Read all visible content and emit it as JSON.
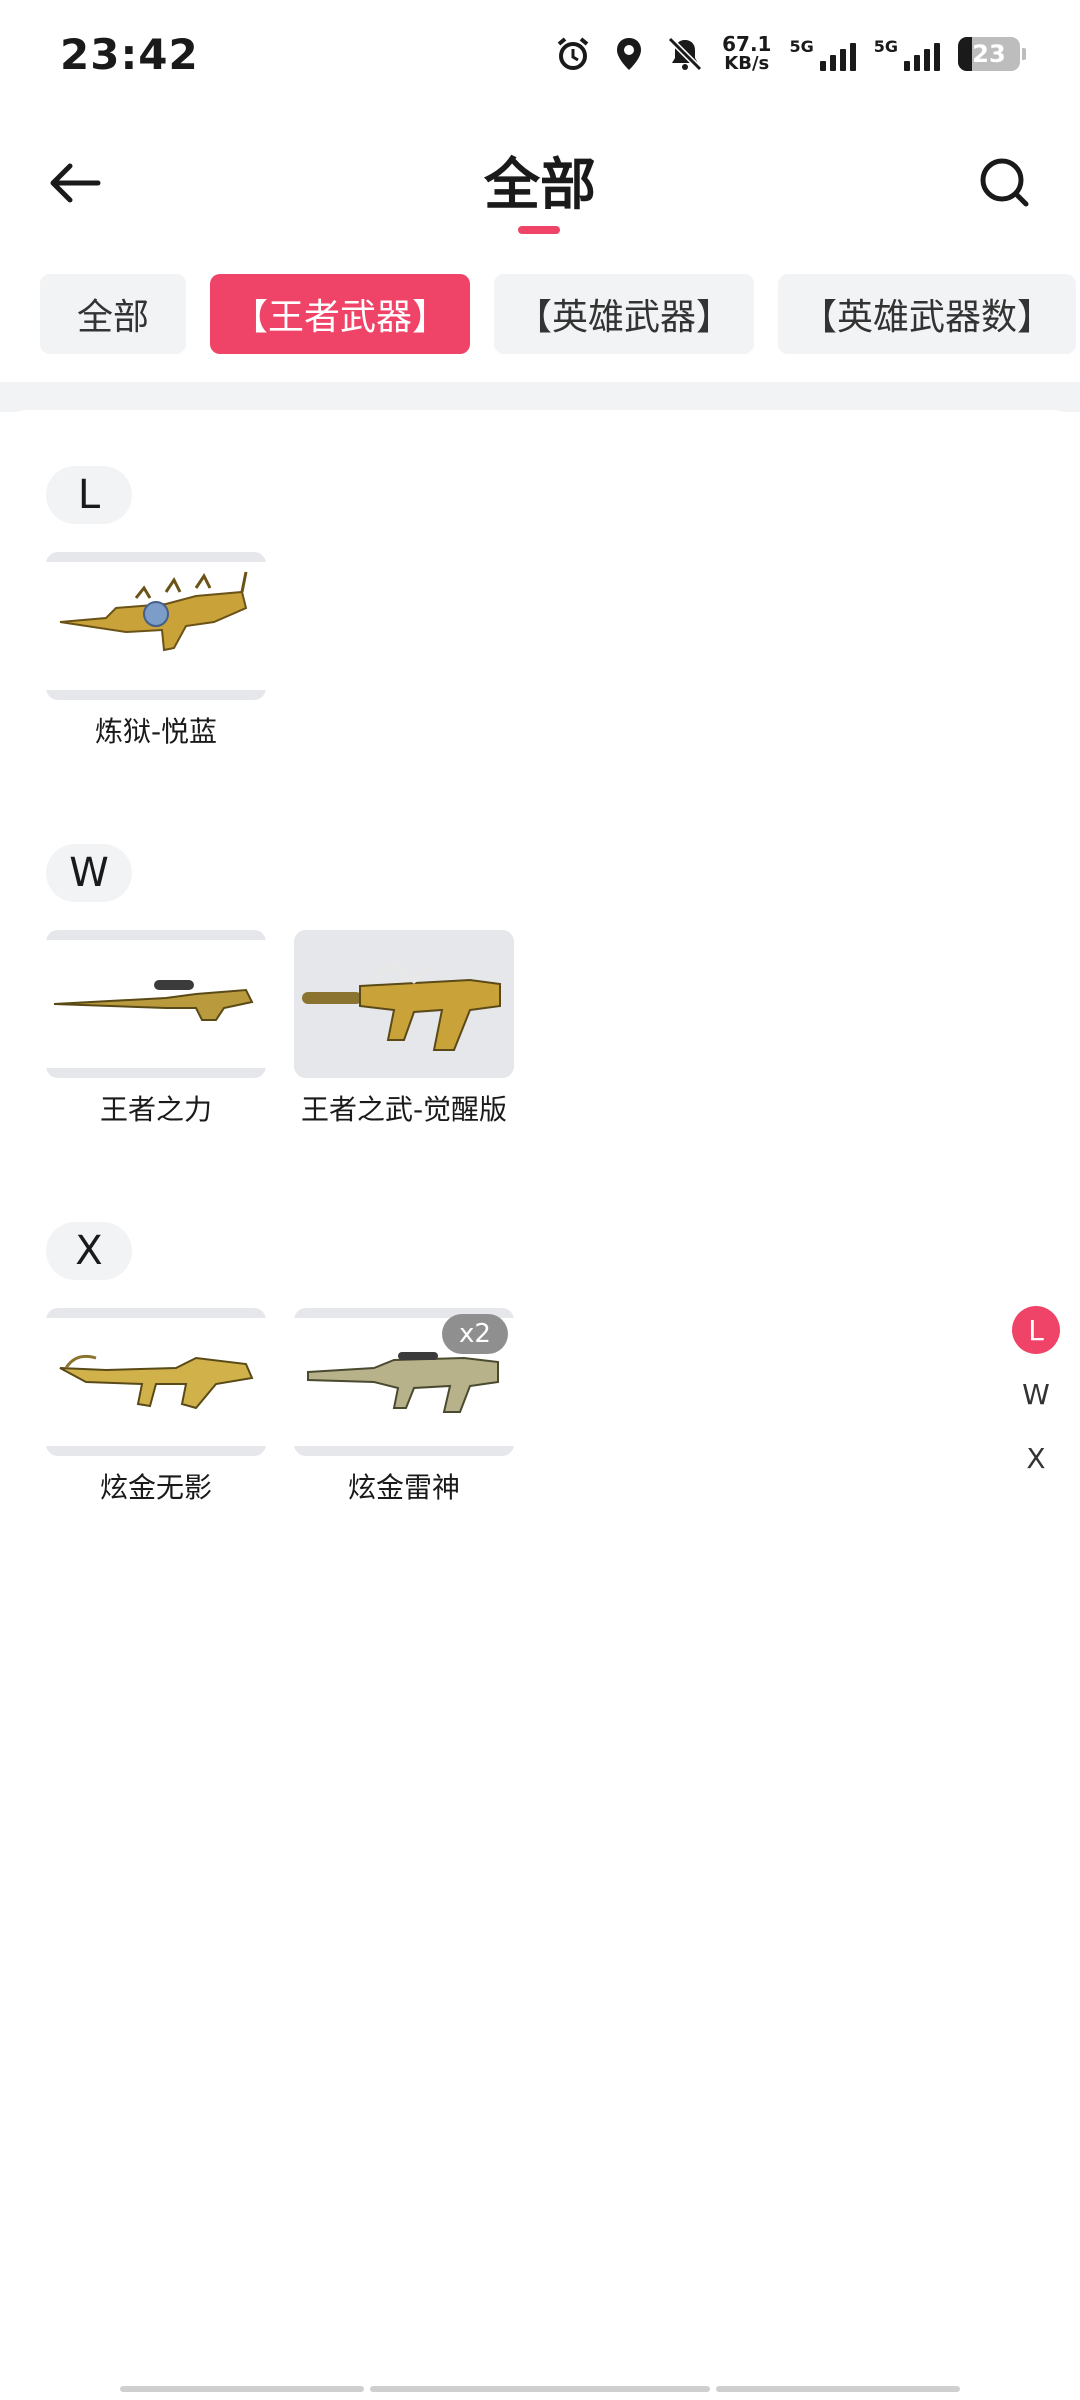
{
  "status_bar": {
    "time": "23:42",
    "net_speed_value": "67.1",
    "net_speed_unit": "KB/s",
    "sim1_label": "5G",
    "sim2_label": "5G",
    "battery": "23",
    "icons": [
      "alarm-icon",
      "location-icon",
      "mute-icon"
    ]
  },
  "header": {
    "title": "全部"
  },
  "tabs": [
    {
      "label": "全部",
      "active": false
    },
    {
      "label": "【王者武器】",
      "active": true
    },
    {
      "label": "【英雄武器】",
      "active": false
    },
    {
      "label": "【英雄武器数】",
      "active": false
    }
  ],
  "sections": [
    {
      "letter": "L",
      "items": [
        {
          "name": "炼狱-悦蓝",
          "badge": ""
        }
      ]
    },
    {
      "letter": "W",
      "items": [
        {
          "name": "王者之力",
          "badge": ""
        },
        {
          "name": "王者之武-觉醒版",
          "badge": ""
        }
      ]
    },
    {
      "letter": "X",
      "items": [
        {
          "name": "炫金无影",
          "badge": ""
        },
        {
          "name": "炫金雷神",
          "badge": "x2"
        }
      ]
    }
  ],
  "side_index": [
    {
      "letter": "L",
      "active": true
    },
    {
      "letter": "W",
      "active": false
    },
    {
      "letter": "X",
      "active": false
    }
  ],
  "colors": {
    "accent": "#ef4467",
    "chip_bg": "#f1f3f5",
    "badge_bg": "#8f8f8f"
  }
}
